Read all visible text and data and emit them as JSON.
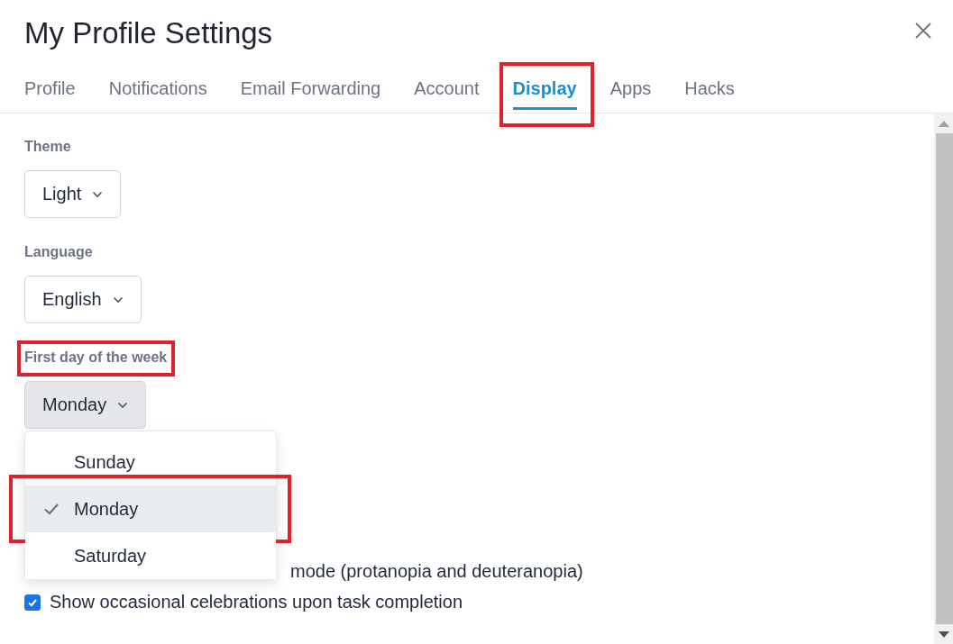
{
  "window": {
    "title": "My Profile Settings"
  },
  "tabs": [
    {
      "label": "Profile",
      "selected": false,
      "highlighted": false
    },
    {
      "label": "Notifications",
      "selected": false,
      "highlighted": false
    },
    {
      "label": "Email Forwarding",
      "selected": false,
      "highlighted": false
    },
    {
      "label": "Account",
      "selected": false,
      "highlighted": false
    },
    {
      "label": "Display",
      "selected": true,
      "highlighted": true
    },
    {
      "label": "Apps",
      "selected": false,
      "highlighted": false
    },
    {
      "label": "Hacks",
      "selected": false,
      "highlighted": false
    }
  ],
  "fields": [
    {
      "label": "Theme",
      "value": "Light",
      "open": false,
      "highlighted": false
    },
    {
      "label": "Language",
      "value": "English",
      "open": false,
      "highlighted": false
    },
    {
      "label": "First day of the week",
      "value": "Monday",
      "open": true,
      "highlighted": true
    }
  ],
  "menu": [
    {
      "label": "Sunday",
      "selected": false,
      "highlighted": false
    },
    {
      "label": "Monday",
      "selected": true,
      "highlighted": true
    },
    {
      "label": "Saturday",
      "selected": false,
      "highlighted": false
    }
  ],
  "options": [
    {
      "label": "mode (protanopia and deuteranopia)"
    },
    {
      "label": "Show occasional celebrations upon task completion",
      "checked": true
    }
  ]
}
